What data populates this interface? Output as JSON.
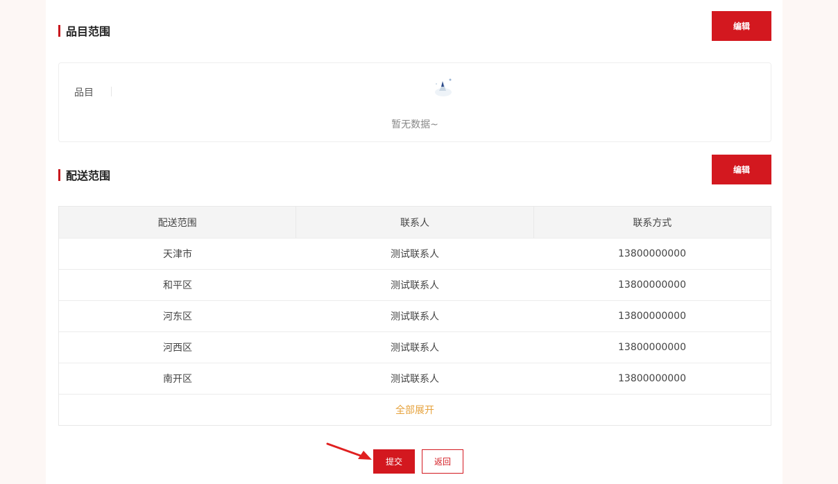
{
  "category_section": {
    "title": "品目范围",
    "edit_label": "编辑",
    "field_label": "品目",
    "empty_text": "暂无数据~"
  },
  "delivery_section": {
    "title": "配送范围",
    "edit_label": "编辑",
    "columns": [
      "配送范围",
      "联系人",
      "联系方式"
    ],
    "rows": [
      [
        "天津市",
        "测试联系人",
        "13800000000"
      ],
      [
        "和平区",
        "测试联系人",
        "13800000000"
      ],
      [
        "河东区",
        "测试联系人",
        "13800000000"
      ],
      [
        "河西区",
        "测试联系人",
        "13800000000"
      ],
      [
        "南开区",
        "测试联系人",
        "13800000000"
      ]
    ],
    "expand_label": "全部展开"
  },
  "actions": {
    "submit_label": "提交",
    "back_label": "返回"
  },
  "colors": {
    "accent": "#d3181f",
    "expand_link": "#e6a23c"
  }
}
